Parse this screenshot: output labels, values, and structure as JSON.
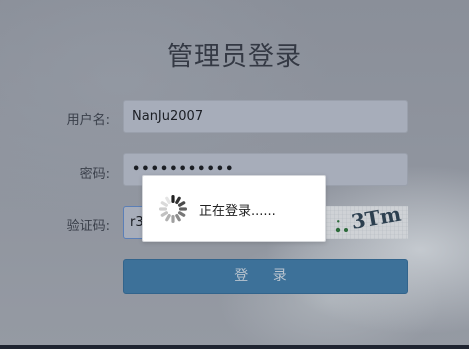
{
  "page": {
    "title": "管理员登录"
  },
  "form": {
    "username_label": "用户名:",
    "username_value": "NanJu2007",
    "password_label": "密码:",
    "password_value": "•••••••••••",
    "captcha_label": "验证码:",
    "captcha_value": "r3",
    "captcha_image_text": "3Tm",
    "login_button": "登 录"
  },
  "loading_dialog": {
    "text": "正在登录......",
    "icon": "spinner-icon"
  },
  "colors": {
    "background": "#8d929c",
    "input_bg": "#a7adba",
    "button_bg": "#3d7199",
    "dialog_bg": "#ffffff"
  }
}
